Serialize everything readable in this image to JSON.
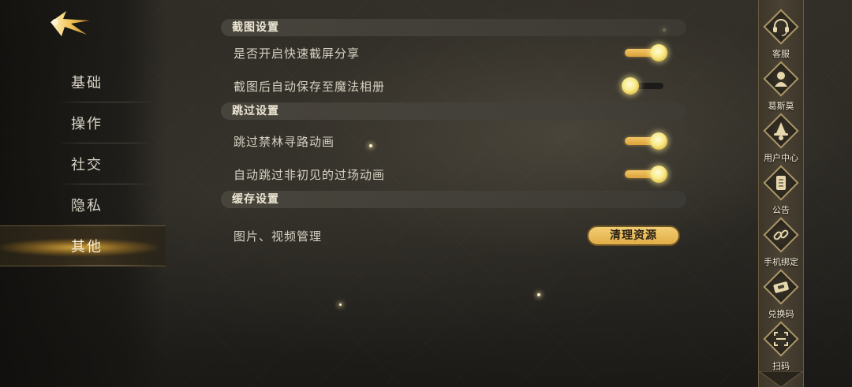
{
  "nav": {
    "items": [
      {
        "label": "基础"
      },
      {
        "label": "操作"
      },
      {
        "label": "社交"
      },
      {
        "label": "隐私"
      },
      {
        "label": "其他"
      }
    ],
    "active_index": 4
  },
  "sections": {
    "screenshot": {
      "title": "截图设置",
      "quick_share": {
        "label": "是否开启快速截屏分享",
        "on": true
      },
      "auto_save": {
        "label": "截图后自动保存至魔法相册",
        "on": false
      }
    },
    "skip": {
      "title": "跳过设置",
      "forest_anim": {
        "label": "跳过禁林寻路动画",
        "on": true
      },
      "cutscene_anim": {
        "label": "自动跳过非初见的过场动画",
        "on": true
      }
    },
    "cache": {
      "title": "缓存设置",
      "media": {
        "label": "图片、视频管理",
        "button": "清理资源"
      }
    }
  },
  "rail": {
    "items": [
      {
        "label": "客服",
        "icon": "headset-icon"
      },
      {
        "label": "葛斯莫",
        "icon": "character-icon"
      },
      {
        "label": "用户中心",
        "icon": "wizard-hat-icon"
      },
      {
        "label": "公告",
        "icon": "scroll-icon"
      },
      {
        "label": "手机绑定",
        "icon": "link-icon"
      },
      {
        "label": "兑换码",
        "icon": "ticket-icon"
      },
      {
        "label": "扫码",
        "icon": "scan-icon"
      }
    ]
  },
  "colors": {
    "accent_gold": "#e8b54f",
    "knob_glow": "#f8ea88",
    "text_light": "#d6d1c3"
  }
}
